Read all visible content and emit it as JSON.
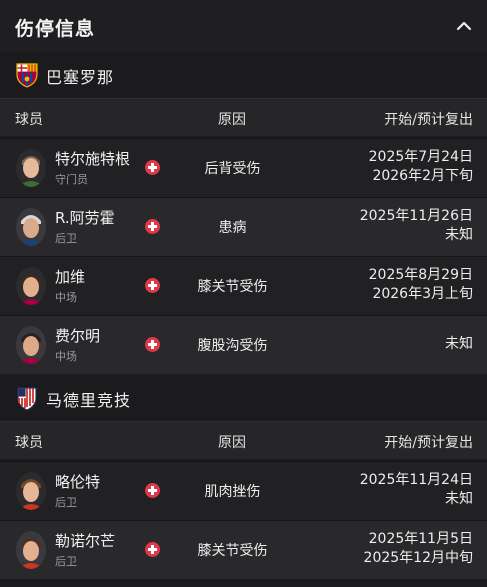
{
  "header": {
    "title": "伤停信息"
  },
  "columns": {
    "player": "球员",
    "reason": "原因",
    "dates": "开始/预计复出"
  },
  "teams": [
    {
      "name": "巴塞罗那",
      "crest": "barcelona-crest",
      "players": [
        {
          "name": "特尔施特根",
          "position": "守门员",
          "reason": "后背受伤",
          "start": "2025年7月24日",
          "return": "2026年2月下旬"
        },
        {
          "name": "R.阿劳霍",
          "position": "后卫",
          "reason": "患病",
          "start": "2025年11月26日",
          "return": "未知"
        },
        {
          "name": "加维",
          "position": "中场",
          "reason": "膝关节受伤",
          "start": "2025年8月29日",
          "return": "2026年3月上旬"
        },
        {
          "name": "费尔明",
          "position": "中场",
          "reason": "腹股沟受伤",
          "start": "",
          "return": "未知"
        }
      ]
    },
    {
      "name": "马德里竞技",
      "crest": "atletico-madrid-crest",
      "players": [
        {
          "name": "略伦特",
          "position": "后卫",
          "reason": "肌肉挫伤",
          "start": "2025年11月24日",
          "return": "未知"
        },
        {
          "name": "勒诺尔芒",
          "position": "后卫",
          "reason": "膝关节受伤",
          "start": "2025年11月5日",
          "return": "2025年12月中旬"
        }
      ]
    }
  ],
  "colors": {
    "injury_badge": "#e0374a",
    "background": "#1b1b1d",
    "row_alt": "#29292c"
  }
}
